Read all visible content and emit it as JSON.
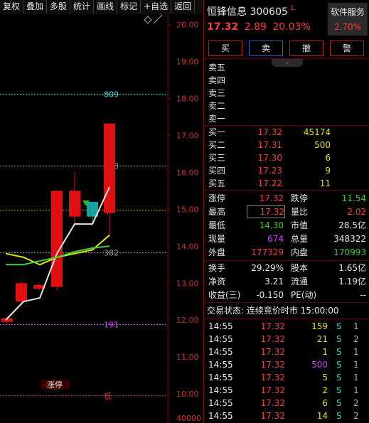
{
  "toolbar": {
    "items": [
      "复权",
      "叠加",
      "多股",
      "统计",
      "画线",
      "标记",
      "+自选",
      "返回"
    ]
  },
  "stock": {
    "name": "恒锋信息",
    "code": "300605",
    "flag": "L",
    "price": "17.32",
    "change": "2.89",
    "change_pct": "20.03%",
    "service_label": "软件服务",
    "service_pct": "2.70%"
  },
  "actions": {
    "buy": "买",
    "sell": "卖",
    "cancel": "撤",
    "alert": "警"
  },
  "sell_levels": [
    {
      "label": "卖五"
    },
    {
      "label": "卖四"
    },
    {
      "label": "卖三"
    },
    {
      "label": "卖二"
    },
    {
      "label": "卖一"
    }
  ],
  "buy_levels": [
    {
      "label": "买一",
      "price": "17.32",
      "volume": "45174"
    },
    {
      "label": "买二",
      "price": "17.31",
      "volume": "500"
    },
    {
      "label": "买三",
      "price": "17.30",
      "volume": "6"
    },
    {
      "label": "买四",
      "price": "17.23",
      "volume": "9"
    },
    {
      "label": "买五",
      "price": "17.22",
      "volume": "11"
    }
  ],
  "stats": [
    {
      "l1": "涨停",
      "v1": "17.32",
      "c1": "red",
      "l2": "跌停",
      "v2": "11.54",
      "c2": "grn"
    },
    {
      "l1": "最高",
      "v1": "17.32",
      "c1": "red",
      "l2": "量比",
      "v2": "2.02",
      "c2": "red"
    },
    {
      "l1": "最低",
      "v1": "14.30",
      "c1": "grn",
      "l2": "市值",
      "v2": "28.5亿",
      "c2": "wht"
    },
    {
      "l1": "现量",
      "v1": "674",
      "c1": "pur",
      "l2": "总量",
      "v2": "348322",
      "c2": "wht"
    },
    {
      "l1": "外盘",
      "v1": "177329",
      "c1": "red",
      "l2": "内盘",
      "v2": "170993",
      "c2": "grn"
    }
  ],
  "stats2": [
    {
      "l1": "换手",
      "v1": "29.29%",
      "l2": "股本",
      "v2": "1.65亿"
    },
    {
      "l1": "净资",
      "v1": "3.21",
      "l2": "流通",
      "v2": "1.19亿"
    },
    {
      "l1": "收益(三)",
      "v1": "-0.150",
      "l2": "PE(动)",
      "v2": "--"
    }
  ],
  "trade_status": "交易状态: 连续竞价时市 15:00:00",
  "ticks": [
    {
      "time": "14:55",
      "price": "17.32",
      "vol": "159",
      "vc": "yel",
      "side": "S",
      "n": "1"
    },
    {
      "time": "14:55",
      "price": "17.32",
      "vol": "21",
      "vc": "yel",
      "side": "S",
      "n": "2"
    },
    {
      "time": "14:55",
      "price": "17.32",
      "vol": "1",
      "vc": "yel",
      "side": "S",
      "n": "1"
    },
    {
      "time": "14:55",
      "price": "17.32",
      "vol": "500",
      "vc": "pur",
      "side": "S",
      "n": "1"
    },
    {
      "time": "14:55",
      "price": "17.32",
      "vol": "5",
      "vc": "yel",
      "side": "S",
      "n": "1"
    },
    {
      "time": "14:55",
      "price": "17.32",
      "vol": "2",
      "vc": "yel",
      "side": "S",
      "n": "1"
    },
    {
      "time": "14:55",
      "price": "17.32",
      "vol": "6",
      "vc": "yel",
      "side": "S",
      "n": "2"
    },
    {
      "time": "14:55",
      "price": "17.32",
      "vol": "14",
      "vc": "yel",
      "side": "S",
      "n": "2"
    }
  ],
  "chart_data": {
    "type": "candlestick",
    "y_axis_ticks": [
      "20.00",
      "19.00",
      "18.00",
      "17.00",
      "16.00",
      "15.00",
      "14.00",
      "13.00",
      "12.00",
      "11.00",
      "10.00"
    ],
    "ylim": [
      9.6,
      20.2
    ],
    "volume_label": "40000",
    "fib_levels": [
      {
        "label": "809",
        "price": 18.11,
        "color": "#40e0e0"
      },
      {
        "label": "618",
        "price": 16.17,
        "color": "#a0a0a0"
      },
      {
        "label": "中",
        "price": 14.97,
        "color": "#e0b000"
      },
      {
        "label": "382",
        "price": 13.82,
        "color": "#a0a0a0"
      },
      {
        "label": "191",
        "price": 11.88,
        "color": "#d040ff"
      },
      {
        "label": "低",
        "price": 9.95,
        "color": "#d04040"
      }
    ],
    "limit_up_tag": "涨停",
    "candles": [
      {
        "x": 2,
        "o": 11.95,
        "c": 12.05,
        "h": 12.1,
        "l": 11.9,
        "up": true
      },
      {
        "x": 22,
        "o": 12.5,
        "c": 13.0,
        "h": 13.05,
        "l": 12.4,
        "up": true
      },
      {
        "x": 47,
        "o": 12.85,
        "c": 12.95,
        "h": 13.0,
        "l": 12.8,
        "up": true
      },
      {
        "x": 72,
        "o": 12.9,
        "c": 15.5,
        "h": 15.5,
        "l": 12.8,
        "up": true
      },
      {
        "x": 97,
        "o": 15.5,
        "c": 14.8,
        "h": 16.0,
        "l": 14.6,
        "up": true
      },
      {
        "x": 122,
        "o": 14.8,
        "c": 15.2,
        "h": 15.2,
        "l": 14.6,
        "up": false
      },
      {
        "x": 146,
        "o": 14.9,
        "c": 17.32,
        "h": 17.32,
        "l": 14.3,
        "up": true
      }
    ],
    "lines": [
      {
        "color": "#e6e6e6",
        "points": [
          [
            0,
            12.0
          ],
          [
            25,
            12.5
          ],
          [
            48,
            12.6
          ],
          [
            72,
            13.8
          ],
          [
            97,
            14.6
          ],
          [
            122,
            14.6
          ],
          [
            146,
            15.6
          ]
        ]
      },
      {
        "color": "#e6e600",
        "points": [
          [
            0,
            13.8
          ],
          [
            25,
            13.7
          ],
          [
            48,
            13.5
          ],
          [
            72,
            13.7
          ],
          [
            97,
            13.8
          ],
          [
            122,
            13.9
          ],
          [
            146,
            14.3
          ]
        ]
      },
      {
        "color": "#40d040",
        "points": [
          [
            0,
            13.5
          ],
          [
            25,
            13.5
          ],
          [
            48,
            13.6
          ],
          [
            72,
            13.7
          ],
          [
            97,
            13.85
          ],
          [
            122,
            13.95
          ],
          [
            146,
            14.0
          ]
        ]
      }
    ]
  }
}
